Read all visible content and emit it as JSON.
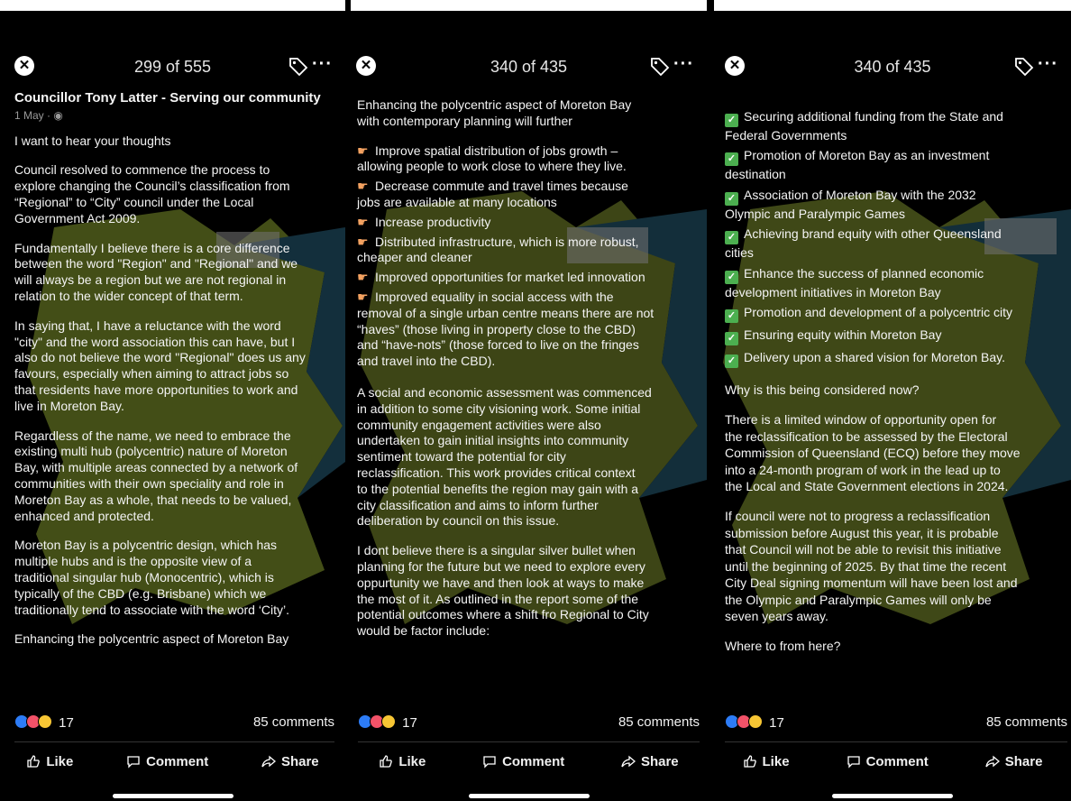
{
  "panels": [
    {
      "counter": "299 of 555",
      "author": "Councillor Tony Latter - Serving our community",
      "date": "1 May · ",
      "paragraphs": [
        "I want to hear your thoughts",
        "Council resolved to commence the process to\nexplore changing the Council’s classification from\n“Regional” to “City” council under the Local\nGovernment Act 2009.",
        "Fundamentally I believe there is a core difference\nbetween the word \"Region\" and \"Regional\" and we\nwill always be a region but we are not regional in\nrelation to the wider concept of that term.",
        "In saying that, I have a reluctance with the word\n\"city\" and the word association this can have, but I\nalso do not believe the word \"Regional\" does us any\nfavours, especially when aiming to attract jobs so\nthat residents have more opportunities to work and\nlive in Moreton Bay.",
        "Regardless of the name, we need to embrace the\nexisting multi hub (polycentric) nature of Moreton\nBay, with multiple areas connected by a network of\ncommunities with their own speciality and role in\nMoreton Bay as a whole, that needs to be valued,\nenhanced and protected.",
        "Moreton Bay is a polycentric design, which has\nmultiple hubs and is the opposite view of a\ntraditional singular hub (Monocentric), which is\ntypically of the CBD (e.g. Brisbane) which we\ntraditionally tend to associate with the word ‘City’.",
        "Enhancing the polycentric aspect of Moreton Bay"
      ],
      "reactions": "17",
      "comments": "85 comments"
    },
    {
      "counter": "340 of 435",
      "intro": "Enhancing the polycentric aspect of Moreton Bay\nwith contemporary planning will further",
      "bullets": [
        "Improve spatial distribution of jobs growth –\nallowing people to work close to where they live.",
        "Decrease commute and travel times because\njobs are available at many locations",
        "Increase productivity",
        "Distributed infrastructure, which is more robust,\ncheaper and cleaner",
        "Improved opportunities for market led innovation",
        "Improved equality in social access with the\nremoval of a single urban centre means there are not\n“haves” (those living in property close to the CBD)\nand “have-nots” (those forced to live on the fringes\nand travel into the CBD)."
      ],
      "paragraphs": [
        "A social and economic assessment was commenced\nin addition to some city visioning work. Some initial\ncommunity engagement activities were also\nundertaken to gain initial insights into community\nsentiment toward the potential for city\nreclassification. This work provides critical context\nto the potential benefits the region may gain with a\ncity classification and aims to inform further\ndeliberation by council on this issue.",
        "I dont believe there is a singular silver bullet when\nplanning for the future but we need to explore every\noppurtunity we have and then look at ways to make\nthe most of it. As outlined in the report some of the\npotential outcomes where a shift fro Regional to City\nwould be factor include:"
      ],
      "reactions": "17",
      "comments": "85 comments"
    },
    {
      "counter": "340 of 435",
      "checks": [
        "Securing additional funding from the State and\nFederal Governments",
        "Promotion of Moreton Bay as an investment\ndestination",
        "Association of Moreton Bay with the 2032\nOlympic and Paralympic Games",
        "Achieving brand equity with other Queensland\ncities",
        "Enhance the success of planned economic\ndevelopment initiatives in Moreton Bay",
        "Promotion and development of a polycentric city",
        "Ensuring equity within Moreton Bay",
        "Delivery upon a shared vision for Moreton Bay."
      ],
      "paragraphs": [
        "Why is this being considered now?",
        "There is a limited window of opportunity open for\nthe reclassification to be assessed by the Electoral\nCommission of Queensland (ECQ) before they move\ninto a 24-month program of work in the lead up to\nthe Local and State Government elections in 2024.",
        "If council were not to progress a reclassification\nsubmission before August this year, it is probable\nthat Council will not be able to revisit this initiative\nuntil the beginning of 2025. By that time the recent\nCity Deal signing momentum will have been lost and\nthe Olympic and Paralympic Games will only be\nseven years away.",
        "Where to from here?"
      ],
      "reactions": "17",
      "comments": "85 comments"
    }
  ],
  "actions": {
    "like": "Like",
    "comment": "Comment",
    "share": "Share"
  },
  "icons": {
    "close": "close-icon",
    "tag": "tag-icon",
    "more": "more-icon",
    "bullet": "pointing-hand-icon",
    "check": "check-mark-icon"
  },
  "colors": {
    "background": "#000000",
    "check_green": "#4caf50",
    "like_blue": "#2d7cf6",
    "haha_yellow": "#f7c634"
  }
}
